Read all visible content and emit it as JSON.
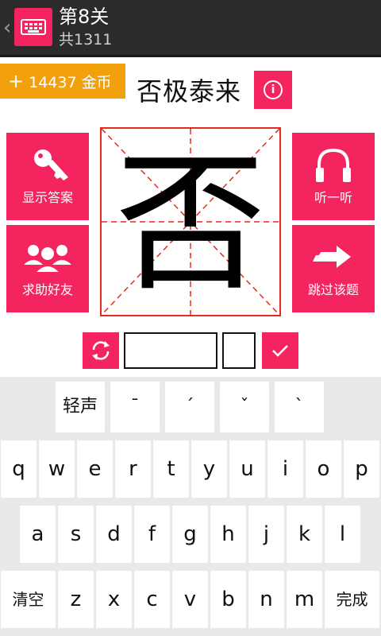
{
  "header": {
    "title": "第8关",
    "subtitle": "共1311",
    "back_glyph": "‹"
  },
  "coins": {
    "plus": "+",
    "text": "14437 金币"
  },
  "word": "否极泰来",
  "character": "否",
  "tiles": {
    "show_answer": "显示答案",
    "ask_friends": "求助好友",
    "listen": "听一听",
    "skip": "跳过该题"
  },
  "tones": [
    "轻声",
    "ˉ",
    "ˊ",
    "ˇ",
    "ˋ"
  ],
  "keyboard": {
    "row1": [
      "q",
      "w",
      "e",
      "r",
      "t",
      "y",
      "u",
      "i",
      "o",
      "p"
    ],
    "row2": [
      "a",
      "s",
      "d",
      "f",
      "g",
      "h",
      "j",
      "k",
      "l"
    ],
    "row3": [
      "z",
      "x",
      "c",
      "v",
      "b",
      "n",
      "m"
    ],
    "clear": "清空",
    "done": "完成"
  },
  "colors": {
    "accent": "#f4245f",
    "coins": "#f2a10d",
    "grid_lines": "#e32b1f",
    "actionbar": "#2b2b2b"
  },
  "icons": [
    "back-chevron-icon",
    "keyboard-app-icon",
    "info-icon",
    "key-icon",
    "friends-icon",
    "headphones-icon",
    "arrow-right-icon",
    "refresh-icon",
    "check-icon"
  ]
}
